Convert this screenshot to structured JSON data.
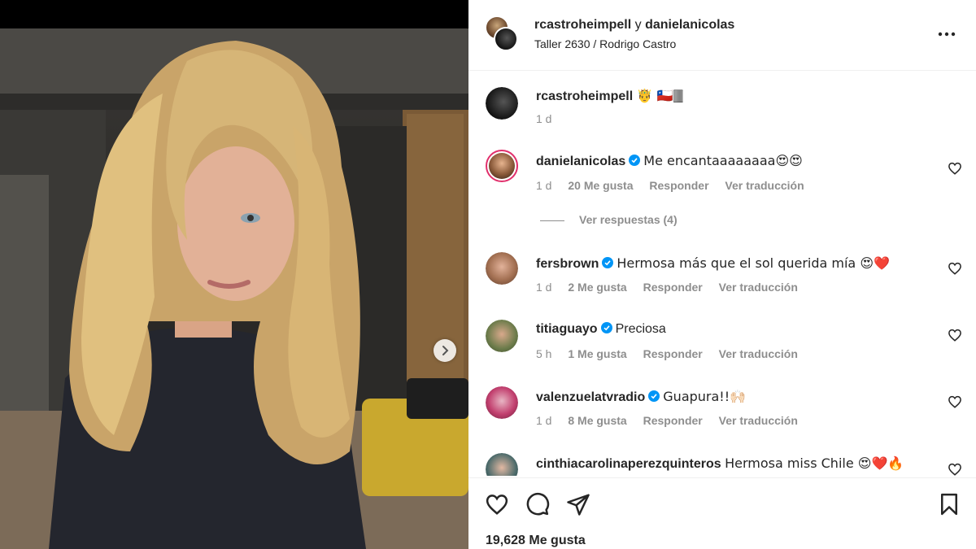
{
  "post": {
    "header": {
      "author": "rcastroheimpell",
      "connector": "y",
      "coauthor": "danielanicolas",
      "location": "Taller 2630 / Rodrigo Castro"
    },
    "caption": {
      "user": "rcastroheimpell",
      "text": "🤴 🇨🇱🀫",
      "time": "1 d"
    },
    "comments": [
      {
        "user": "danielanicolas",
        "verified": true,
        "text": "Me encantaaaaaaaa😍😍",
        "time": "1 d",
        "likes": "20 Me gusta",
        "reply": "Responder",
        "translate": "Ver traducción"
      },
      {
        "user": "fersbrown",
        "verified": true,
        "text": "Hermosa más que el sol querida mía 😍❤️",
        "time": "1 d",
        "likes": "2 Me gusta",
        "reply": "Responder",
        "translate": "Ver traducción"
      },
      {
        "user": "titiaguayo",
        "verified": true,
        "text": "Preciosa",
        "time": "5 h",
        "likes": "1 Me gusta",
        "reply": "Responder",
        "translate": "Ver traducción"
      },
      {
        "user": "valenzuelatvradio",
        "verified": true,
        "text": "Guapura!!🙌🏻",
        "time": "1 d",
        "likes": "8 Me gusta",
        "reply": "Responder",
        "translate": "Ver traducción"
      },
      {
        "user": "cinthiacarolinaperezquinteros",
        "verified": false,
        "text": "Hermosa miss Chile 😍❤️🔥"
      }
    ],
    "view_replies": "Ver respuestas (4)",
    "likes_total": "19,628 Me gusta"
  },
  "colors": {
    "verified": "#0095f6",
    "muted": "#8e8e8e",
    "text": "#262626",
    "story_ring": "#e1306c"
  },
  "icons": {
    "more": "more-horizontal-icon",
    "like": "heart-icon",
    "comment": "comment-icon",
    "share": "paper-plane-icon",
    "save": "bookmark-icon",
    "carousel": "chevron-right-icon"
  }
}
